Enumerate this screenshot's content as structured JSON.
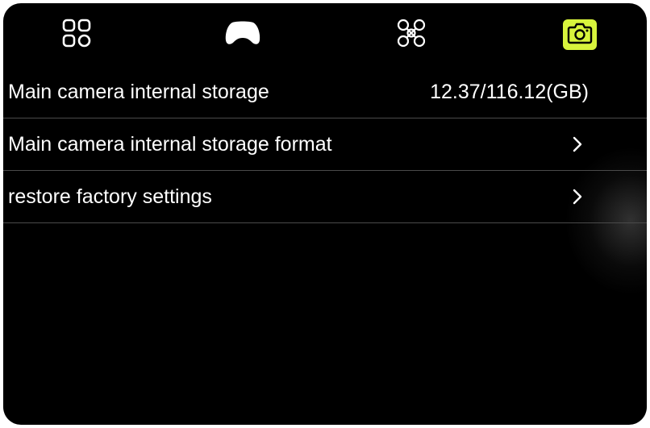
{
  "colors": {
    "background": "#000000",
    "text": "#ffffff",
    "accent": "#d8f43c",
    "divider": "#4a4a4a"
  },
  "tabs": [
    {
      "icon": "grid-icon",
      "active": false
    },
    {
      "icon": "gamepad-icon",
      "active": false
    },
    {
      "icon": "drone-icon",
      "active": false
    },
    {
      "icon": "camera-icon",
      "active": true
    }
  ],
  "settings": {
    "storage_label": "Main camera internal storage",
    "storage_value": "12.37/116.12(GB)",
    "format_label": "Main camera internal storage format",
    "factory_label": "restore factory settings"
  }
}
